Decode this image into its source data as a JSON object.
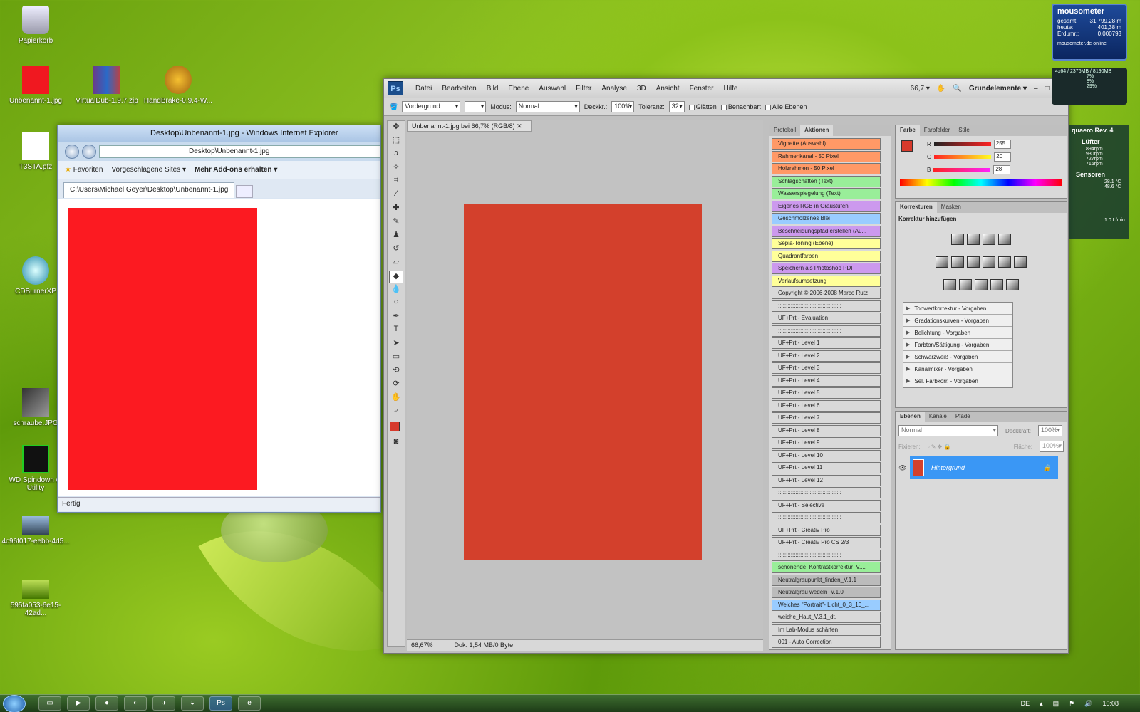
{
  "desktop_icons": [
    {
      "name": "recycle-bin",
      "label": "Papierkorb"
    },
    {
      "name": "red-file",
      "label": "Unbenannt-1.jpg"
    },
    {
      "name": "winrar",
      "label": "VirtualDub-1.9.7.zip"
    },
    {
      "name": "handbrake",
      "label": "HandBrake-0.9.4-W..."
    },
    {
      "name": "t3sta",
      "label": "T3STA.pfz"
    },
    {
      "name": "cdburner",
      "label": "CDBurnerXP"
    },
    {
      "name": "schraube",
      "label": "schraube.JPG"
    },
    {
      "name": "wd",
      "label": "WD Spindown or Utility"
    },
    {
      "name": "file1",
      "label": "4c96f017-eebb-4d5..."
    },
    {
      "name": "file2",
      "label": "595fa053-6e15-42ad..."
    }
  ],
  "ie": {
    "title": "Desktop\\Unbenannt-1.jpg - Windows Internet Explorer",
    "address": "Desktop\\Unbenannt-1.jpg",
    "favorites": "Favoriten",
    "suggested": "Vorgeschlagene Sites",
    "addons": "Mehr Add-ons erhalten",
    "tab": "C:\\Users\\Michael Geyer\\Desktop\\Unbenannt-1.jpg",
    "status": "Fertig",
    "image_color": "#fc1a21"
  },
  "ps": {
    "logo": "Ps",
    "menus": [
      "Datei",
      "Bearbeiten",
      "Bild",
      "Ebene",
      "Auswahl",
      "Filter",
      "Analyse",
      "3D",
      "Ansicht",
      "Fenster",
      "Hilfe"
    ],
    "zoom_menu": "66,7",
    "workspace": "Grundelemente",
    "options": {
      "fill": "Vordergrund",
      "mode_label": "Modus:",
      "mode": "Normal",
      "opacity_label": "Deckkr.:",
      "opacity": "100%",
      "tolerance_label": "Toleranz:",
      "tolerance": "32",
      "smooth": "Glätten",
      "adjacent": "Benachbart",
      "all_layers": "Alle Ebenen"
    },
    "doc_tab": "Unbenannt-1.jpg bei 66,7% (RGB/8)",
    "doc_zoom": "66,67%",
    "doc_info": "Dok: 1,54 MB/0 Byte",
    "canvas_color": "#d3402c",
    "fg_color": "#d63a2c",
    "action_tabs": [
      "Protokoll",
      "Aktionen"
    ],
    "actions": [
      {
        "label": "Vignette (Auswahl)",
        "color": "#ff9966"
      },
      {
        "label": "Rahmenkanal - 50 Pixel",
        "color": "#ff9966"
      },
      {
        "label": "Holzrahmen - 50 Pixel",
        "color": "#ff9966"
      },
      {
        "label": "Schlagschatten (Text)",
        "color": "#99ee99"
      },
      {
        "label": "Wasserspiegelung (Text)",
        "color": "#99ee99"
      },
      {
        "label": "Eigenes RGB in Graustufen",
        "color": "#cc99ee"
      },
      {
        "label": "Geschmolzenes Blei",
        "color": "#99ccff"
      },
      {
        "label": "Beschneidungspfad erstellen (Au...",
        "color": "#cc99ee"
      },
      {
        "label": "Sepia-Toning (Ebene)",
        "color": "#ffff99"
      },
      {
        "label": "Quadrantfarben",
        "color": "#ffff99"
      },
      {
        "label": "Speichern als Photoshop PDF",
        "color": "#cc99ee"
      },
      {
        "label": "Verlaufsumsetzung",
        "color": "#ffff99"
      },
      {
        "label": "Copyright © 2006-2008 Marco Rutz",
        "color": "#d9d9d9"
      },
      {
        "label": "::::::::::::::::::::::::::::::::::::::::",
        "color": "#d9d9d9"
      },
      {
        "label": "UF+Prt - Evaluation",
        "color": "#d9d9d9"
      },
      {
        "label": "::::::::::::::::::::::::::::::::::::::::",
        "color": "#d9d9d9"
      },
      {
        "label": "UF+Prt - Level 1",
        "color": "#d9d9d9"
      },
      {
        "label": "UF+Prt - Level 2",
        "color": "#d9d9d9"
      },
      {
        "label": "UF+Prt - Level 3",
        "color": "#d9d9d9"
      },
      {
        "label": "UF+Prt - Level 4",
        "color": "#d9d9d9"
      },
      {
        "label": "UF+Prt - Level 5",
        "color": "#d9d9d9"
      },
      {
        "label": "UF+Prt - Level 6",
        "color": "#d9d9d9"
      },
      {
        "label": "UF+Prt - Level 7",
        "color": "#d9d9d9"
      },
      {
        "label": "UF+Prt - Level 8",
        "color": "#d9d9d9"
      },
      {
        "label": "UF+Prt - Level 9",
        "color": "#d9d9d9"
      },
      {
        "label": "UF+Prt - Level 10",
        "color": "#d9d9d9"
      },
      {
        "label": "UF+Prt - Level 11",
        "color": "#d9d9d9"
      },
      {
        "label": "UF+Prt - Level 12",
        "color": "#d9d9d9"
      },
      {
        "label": "::::::::::::::::::::::::::::::::::::::::",
        "color": "#d9d9d9"
      },
      {
        "label": "UF+Prt - Selective",
        "color": "#d9d9d9"
      },
      {
        "label": "::::::::::::::::::::::::::::::::::::::::",
        "color": "#d9d9d9"
      },
      {
        "label": "UF+Prt - Creativ Pro",
        "color": "#d9d9d9"
      },
      {
        "label": "UF+Prt - Creativ Pro CS 2/3",
        "color": "#d9d9d9"
      },
      {
        "label": "::::::::::::::::::::::::::::::::::::::::",
        "color": "#d9d9d9"
      },
      {
        "label": "schonende_Kontrastkorrektur_V....",
        "color": "#99ee99"
      },
      {
        "label": "Neutralgraupunkt_finden_V.1.1",
        "color": "#bbbbbb"
      },
      {
        "label": "Neutralgrau wedeln_V.1.0",
        "color": "#bbbbbb"
      },
      {
        "label": "Weiches \"Portrait\"- Licht_0_3_10_...",
        "color": "#99ccff"
      },
      {
        "label": "weiche_Haut_V.3.1_dt.",
        "color": "#d9d9d9"
      },
      {
        "label": "Im Lab-Modus schärfen",
        "color": "#d9d9d9"
      },
      {
        "label": "001 - Auto Correction",
        "color": "#d9d9d9"
      }
    ],
    "color_tabs": [
      "Farbe",
      "Farbfelder",
      "Stile"
    ],
    "rgb": [
      {
        "ch": "R",
        "val": "255"
      },
      {
        "ch": "G",
        "val": "20"
      },
      {
        "ch": "B",
        "val": "28"
      }
    ],
    "adj_tabs": [
      "Korrekturen",
      "Masken"
    ],
    "adj_title": "Korrektur hinzufügen",
    "presets": [
      "Tonwertkorrektur - Vorgaben",
      "Gradationskurven - Vorgaben",
      "Belichtung - Vorgaben",
      "Farbton/Sättigung - Vorgaben",
      "Schwarzweiß - Vorgaben",
      "Kanalmixer - Vorgaben",
      "Sel. Farbkorr. - Vorgaben"
    ],
    "layer_tabs": [
      "Ebenen",
      "Kanäle",
      "Pfade"
    ],
    "blend": "Normal",
    "layer_opacity_label": "Deckkraft:",
    "layer_opacity": "100%",
    "lock_label": "Fixieren:",
    "fill_label": "Fläche:",
    "fill_val": "100%",
    "layer_name": "Hintergrund"
  },
  "gadgets": {
    "mouso_title": "mousometer",
    "mouso_rows": [
      {
        "k": "gesamt:",
        "v": "31.799,28 m"
      },
      {
        "k": "heute:",
        "v": "401,38 m"
      },
      {
        "k": "Erdumr.:",
        "v": "0,000793"
      }
    ],
    "mouso_footer": "mousometer.de  online",
    "cpu_title": "4x64 / 2376MB / 8190MB",
    "cpu_rows": [
      "7%",
      "8%",
      "29%"
    ],
    "aqua_title": "quaero Rev. 4",
    "aqua_fan": "Lüfter",
    "aqua_rows": [
      "894rpm",
      "930rpm",
      "727rpm",
      "716rpm"
    ],
    "aqua_sensors": "Sensoren",
    "aqua_temps": [
      "28.1 °C",
      "48.6 °C"
    ],
    "aqua_flow": "1.0 L/min"
  },
  "taskbar": {
    "lang": "DE",
    "time": "10:08"
  }
}
